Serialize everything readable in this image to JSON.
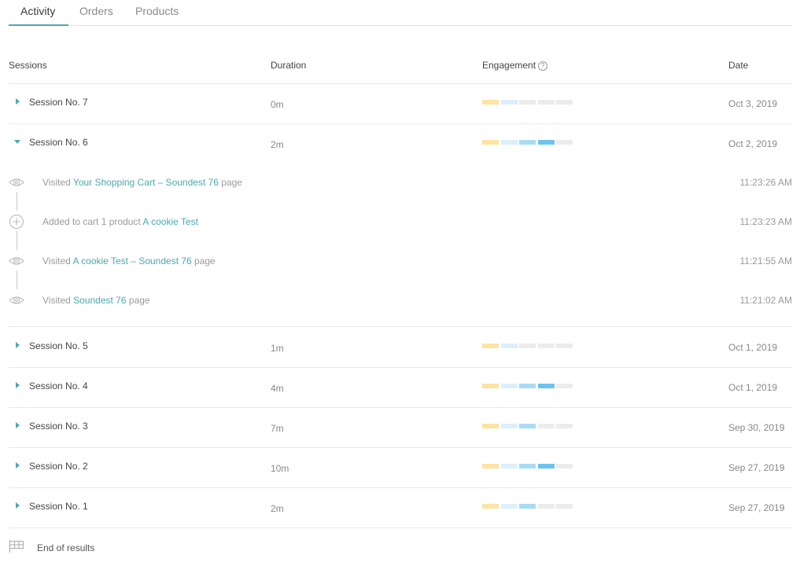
{
  "tabs": [
    {
      "label": "Activity",
      "active": true
    },
    {
      "label": "Orders",
      "active": false
    },
    {
      "label": "Products",
      "active": false
    }
  ],
  "table": {
    "headers": {
      "sessions": "Sessions",
      "duration": "Duration",
      "engagement": "Engagement",
      "date": "Date"
    },
    "engagement_help": "?"
  },
  "sessions": [
    {
      "name": "Session No. 7",
      "duration": "0m",
      "date": "Oct 3, 2019",
      "engagement": [
        1,
        1,
        0,
        0,
        0
      ],
      "expanded": false
    },
    {
      "name": "Session No. 6",
      "duration": "2m",
      "date": "Oct 2, 2019",
      "engagement": [
        1,
        1,
        2,
        3,
        0
      ],
      "expanded": true
    },
    {
      "name": "Session No. 5",
      "duration": "1m",
      "date": "Oct 1, 2019",
      "engagement": [
        1,
        1,
        0,
        0,
        0
      ],
      "expanded": false
    },
    {
      "name": "Session No. 4",
      "duration": "4m",
      "date": "Oct 1, 2019",
      "engagement": [
        1,
        1,
        2,
        3,
        0
      ],
      "expanded": false
    },
    {
      "name": "Session No. 3",
      "duration": "7m",
      "date": "Sep 30, 2019",
      "engagement": [
        1,
        1,
        2,
        0,
        0
      ],
      "expanded": false
    },
    {
      "name": "Session No. 2",
      "duration": "10m",
      "date": "Sep 27, 2019",
      "engagement": [
        1,
        1,
        2,
        3,
        0
      ],
      "expanded": false
    },
    {
      "name": "Session No. 1",
      "duration": "2m",
      "date": "Sep 27, 2019",
      "engagement": [
        1,
        1,
        2,
        0,
        0
      ],
      "expanded": false
    }
  ],
  "engagement_colors": {
    "empty": "#ececec",
    "level1_first": "#fde4a3",
    "level1": "#dcf0fb",
    "level2": "#a8dcf5",
    "level3": "#6ec3ee"
  },
  "activity": [
    {
      "icon": "eye-icon",
      "prefix": "Visited ",
      "link": "Your Shopping Cart – Soundest 76",
      "suffix": " page",
      "time": "11:23:26 AM"
    },
    {
      "icon": "plus-circle-icon",
      "prefix": "Added to cart 1 product ",
      "link": "A cookie Test",
      "suffix": "",
      "time": "11:23:23 AM"
    },
    {
      "icon": "eye-icon",
      "prefix": "Visited ",
      "link": "A cookie Test – Soundest 76",
      "suffix": " page",
      "time": "11:21:55 AM"
    },
    {
      "icon": "eye-icon",
      "prefix": "Visited ",
      "link": "Soundest 76",
      "suffix": " page",
      "time": "11:21:02 AM"
    }
  ],
  "footer": {
    "icon": "grid-flag-icon",
    "label": "End of results"
  }
}
